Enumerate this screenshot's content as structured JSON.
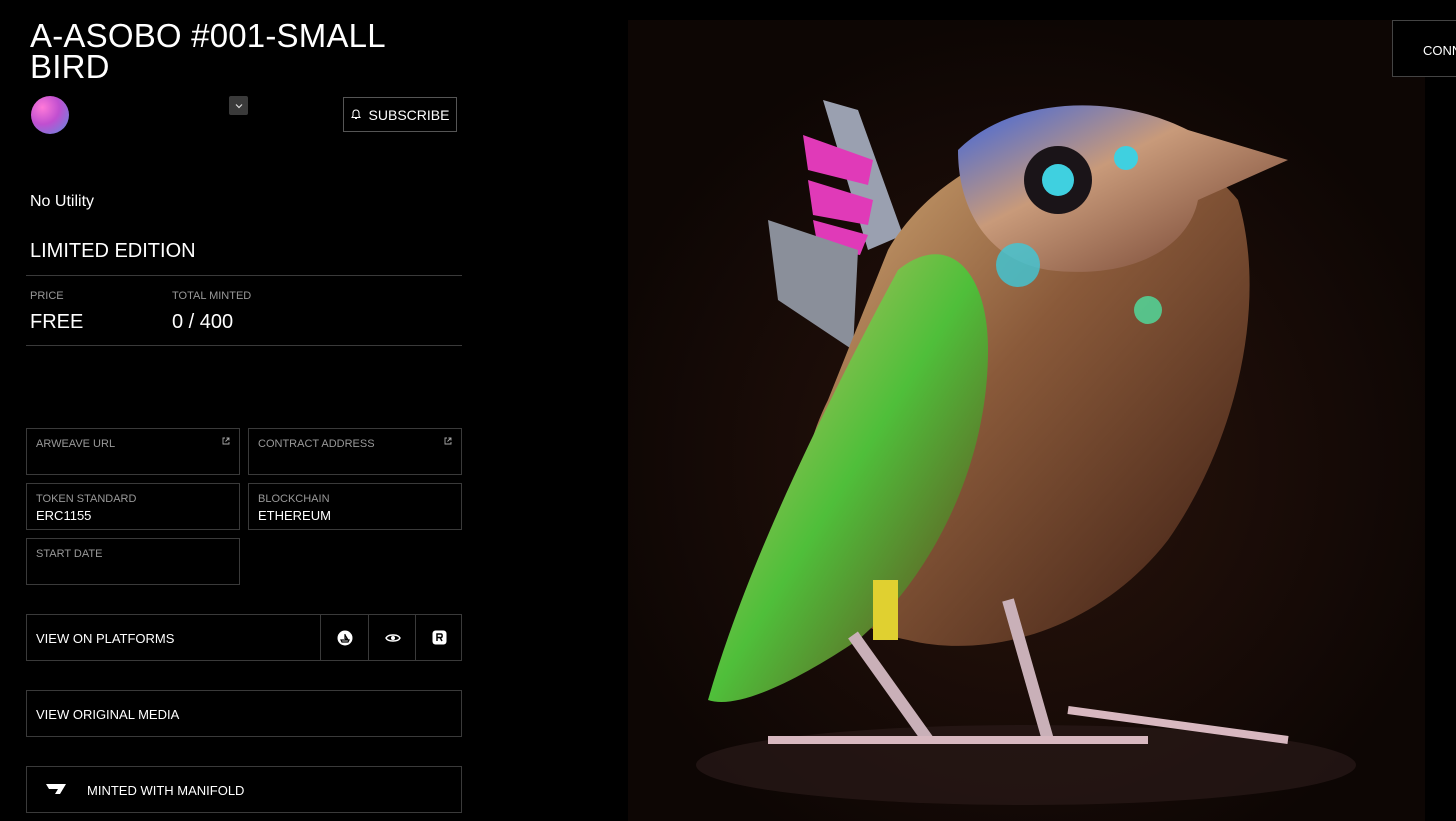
{
  "token": {
    "title": "A-ASOBO #001-SMALL BIRD",
    "utility": "No Utility",
    "edition": "LIMITED EDITION"
  },
  "header": {
    "subscribe_label": "SUBSCRIBE",
    "connect_label": "CONNECT"
  },
  "stats": {
    "price_label": "PRICE",
    "price_value": "FREE",
    "minted_label": "TOTAL MINTED",
    "minted_value": "0 / 400"
  },
  "details": {
    "arweave_label": "ARWEAVE URL",
    "contract_label": "CONTRACT ADDRESS",
    "standard_label": "TOKEN STANDARD",
    "standard_value": "ERC1155",
    "chain_label": "BLOCKCHAIN",
    "chain_value": "ETHEREUM",
    "start_label": "START DATE"
  },
  "actions": {
    "platforms_label": "VIEW ON PLATFORMS",
    "original_label": "VIEW ORIGINAL MEDIA",
    "manifold_label": "MINTED WITH MANIFOLD"
  },
  "icons": [
    "bell-icon",
    "chevron-down-icon",
    "external-link-icon",
    "opensea-icon",
    "eye-icon",
    "rarible-icon",
    "manifold-logo-icon"
  ]
}
